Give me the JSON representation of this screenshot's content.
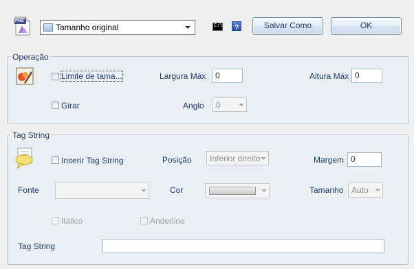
{
  "top": {
    "format_badge": "PNG",
    "size_select": {
      "value": "Tamanho original"
    },
    "cmd_icon_text": "C:\\",
    "help_icon_text": "?",
    "save_as_label": "Salvar Como",
    "ok_label": "OK"
  },
  "operacao": {
    "legend": "Operação",
    "limit_checkbox": {
      "label": "Limite de tama...",
      "checked": false
    },
    "largura_label": "Largura Máx",
    "largura_value": "0",
    "altura_label": "Altura Máx",
    "altura_value": "0",
    "rotate_checkbox": {
      "label": "Girar",
      "checked": false
    },
    "angulo_label": "Anglo",
    "angulo_value": "0"
  },
  "tag": {
    "legend": "Tag String",
    "insert_checkbox": {
      "label": "Inserir Tag String",
      "checked": false
    },
    "posicao_label": "Posição",
    "posicao_value": "Inferior direito",
    "margem_label": "Margem",
    "margem_value": "0",
    "fonte_label": "Fonte",
    "fonte_value": "",
    "cor_label": "Cor",
    "tamanho_label": "Tamanho",
    "tamanho_value": "Auto",
    "italic_checkbox": {
      "label": "Itálico",
      "checked": false
    },
    "underline_checkbox": {
      "label": "Anderline",
      "checked": false
    },
    "tagstring_label": "Tag String",
    "tagstring_value": ""
  },
  "colors": {
    "text": "#1e3c6a",
    "group_border": "#b9c6d4",
    "group_bg": "#eaeff4"
  }
}
